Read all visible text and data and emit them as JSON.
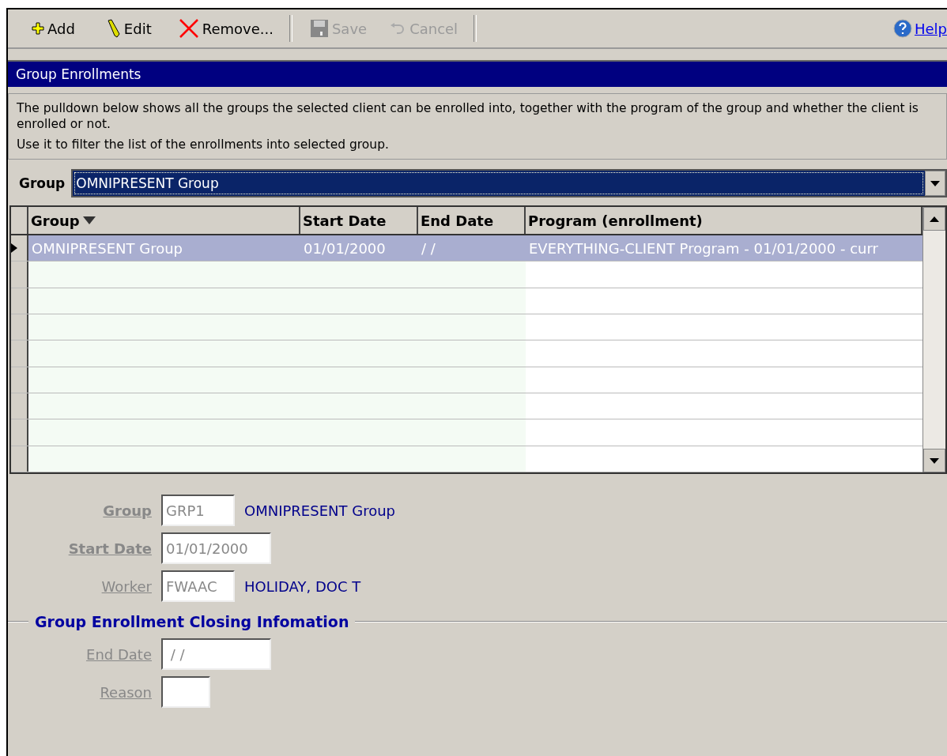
{
  "toolbar": {
    "buttons": [
      {
        "label": "Add",
        "kind": "add",
        "disabled": false
      },
      {
        "label": "Edit",
        "kind": "edit",
        "disabled": false
      },
      {
        "label": "Remove...",
        "kind": "remove",
        "disabled": false
      },
      {
        "label": "Save",
        "kind": "save",
        "disabled": true
      },
      {
        "label": "Cancel",
        "kind": "cancel",
        "disabled": true
      }
    ],
    "help": "Help"
  },
  "panel_title": "Group Enrollments",
  "description": [
    "The pulldown below shows all the groups the selected client can be enrolled into, together with the program of the group and whether the client is enrolled or not.",
    "Use it to filter the list of the enrollments into selected group."
  ],
  "group_filter": {
    "label": "Group",
    "value": "OMNIPRESENT Group"
  },
  "table": {
    "columns": [
      {
        "label": "Group",
        "sorted": true
      },
      {
        "label": "Start Date",
        "sorted": false
      },
      {
        "label": "End Date",
        "sorted": false
      },
      {
        "label": "Program (enrollment)",
        "sorted": false
      }
    ],
    "rows": [
      {
        "selected": true,
        "cells": [
          "OMNIPRESENT Group",
          "01/01/2000",
          "/ /",
          "EVERYTHING-CLIENT Program - 01/01/2000 - curr"
        ]
      }
    ]
  },
  "form": {
    "fields": [
      {
        "label": "Group",
        "required": true,
        "value": "GRP1",
        "description": "OMNIPRESENT Group"
      },
      {
        "label": "Start Date",
        "required": true,
        "value": "01/01/2000"
      },
      {
        "label": "Worker",
        "required": false,
        "value": "FWAAC",
        "description": "HOLIDAY, DOC T"
      }
    ],
    "closing_section": {
      "title": "Group Enrollment Closing Infomation",
      "fields": [
        {
          "label": "End Date",
          "required": false,
          "value": " / /"
        },
        {
          "label": "Reason",
          "required": false
        }
      ]
    }
  }
}
